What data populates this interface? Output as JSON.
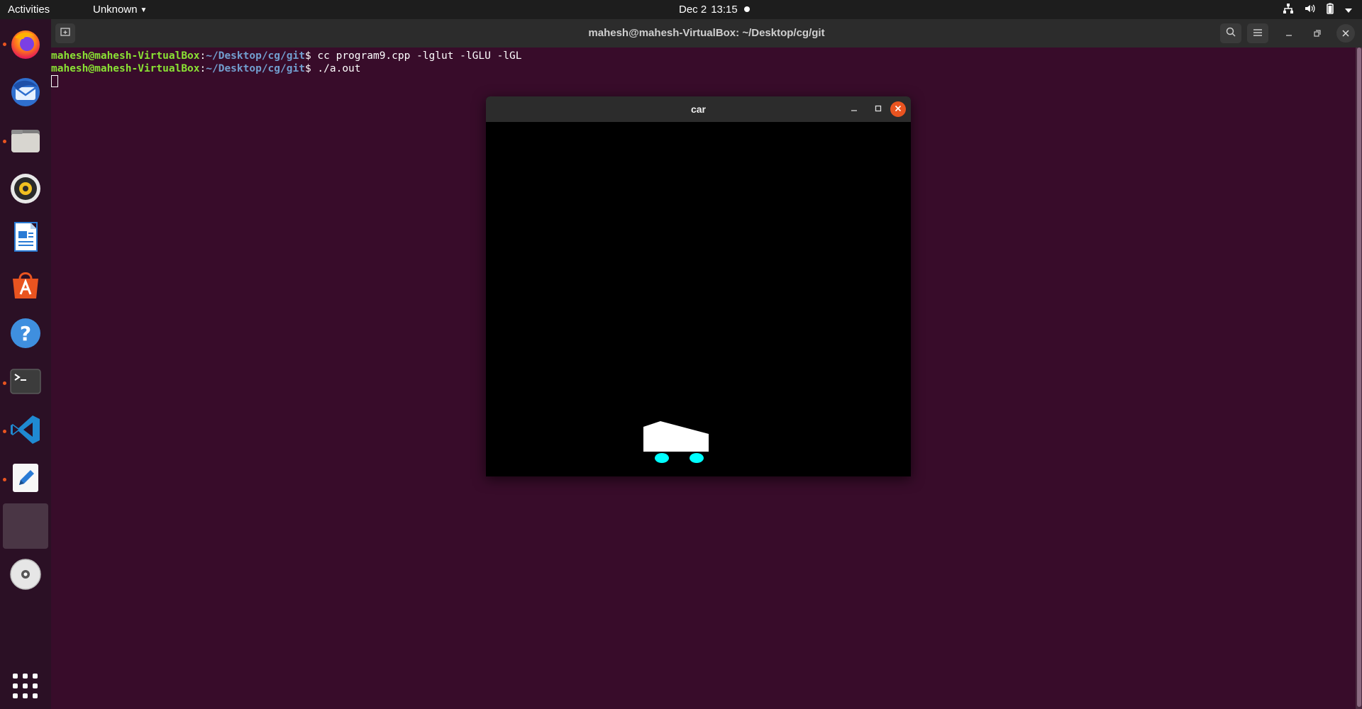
{
  "topbar": {
    "activities": "Activities",
    "app_menu": "Unknown",
    "date": "Dec 2",
    "time": "13:15"
  },
  "dock": {
    "items": [
      {
        "name": "firefox-icon",
        "running": true
      },
      {
        "name": "thunderbird-icon",
        "running": false
      },
      {
        "name": "files-icon",
        "running": true
      },
      {
        "name": "rhythmbox-icon",
        "running": false
      },
      {
        "name": "libreoffice-writer-icon",
        "running": false
      },
      {
        "name": "software-center-icon",
        "running": false
      },
      {
        "name": "help-icon",
        "running": false
      },
      {
        "name": "terminal-icon",
        "running": true
      },
      {
        "name": "vscode-icon",
        "running": true
      },
      {
        "name": "text-editor-icon",
        "running": true
      },
      {
        "name": "active-window-icon",
        "running": true
      },
      {
        "name": "dvd-icon",
        "running": false
      }
    ]
  },
  "terminal": {
    "title": "mahesh@mahesh-VirtualBox: ~/Desktop/cg/git",
    "lines": [
      {
        "user": "mahesh@mahesh-VirtualBox",
        "path": "~/Desktop/cg/git",
        "cmd": " cc program9.cpp -lglut -lGLU -lGL"
      },
      {
        "user": "mahesh@mahesh-VirtualBox",
        "path": "~/Desktop/cg/git",
        "cmd": " ./a.out"
      }
    ]
  },
  "car_window": {
    "title": "car",
    "colors": {
      "body": "#ffffff",
      "wheels": "#00ffff",
      "background": "#000000"
    }
  },
  "colors": {
    "desktop_bg": "#380c2a",
    "accent": "#e95420",
    "prompt_user": "#8ae234",
    "prompt_path": "#729fcf"
  }
}
